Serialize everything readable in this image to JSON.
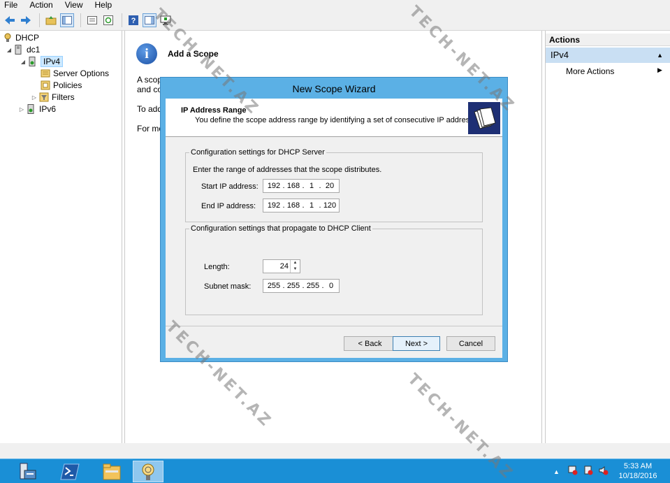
{
  "menu": {
    "items": [
      "File",
      "Action",
      "View",
      "Help"
    ]
  },
  "toolbar": {
    "icons": [
      "back-icon",
      "forward-icon",
      "up-folder-icon",
      "show-hide-tree-icon",
      "properties-icon",
      "refresh-icon",
      "help-icon",
      "action-pane-icon",
      "monitor-icon"
    ]
  },
  "tree": {
    "root": "DHCP",
    "server": "dc1",
    "ipv4": "IPv4",
    "server_options": "Server Options",
    "policies": "Policies",
    "filters": "Filters",
    "ipv6": "IPv6"
  },
  "center": {
    "title": "Add a Scope",
    "line1": "A scop",
    "line2": "and co",
    "line3": "To add",
    "line4": "For mo"
  },
  "actions": {
    "header": "Actions",
    "section": "IPv4",
    "more": "More Actions"
  },
  "dialog": {
    "title": "New Scope Wizard",
    "header_title": "IP Address Range",
    "header_subtitle": "You define the scope address range by identifying a set of consecutive IP addresses.",
    "server_group": "Configuration settings for DHCP Server",
    "range_desc": "Enter the range of addresses that the scope distributes.",
    "start_label": "Start IP address:",
    "start_ip": [
      "192",
      "168",
      "1",
      "20"
    ],
    "end_label": "End IP address:",
    "end_ip": [
      "192",
      "168",
      "1",
      "120"
    ],
    "client_group": "Configuration settings that propagate to DHCP Client",
    "length_label": "Length:",
    "length_value": "24",
    "mask_label": "Subnet mask:",
    "mask": [
      "255",
      "255",
      "255",
      "0"
    ],
    "back": "< Back",
    "next": "Next >",
    "cancel": "Cancel"
  },
  "taskbar": {
    "apps": [
      "server-manager-icon",
      "powershell-icon",
      "file-explorer-icon",
      "dhcp-icon"
    ],
    "time": "5:33 AM",
    "date": "10/18/2016"
  },
  "watermark": "TECH-NET.AZ"
}
